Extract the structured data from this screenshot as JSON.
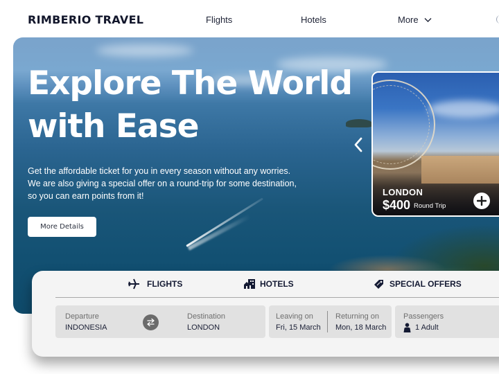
{
  "header": {
    "logo": "RIMBERIO TRAVEL",
    "nav": [
      {
        "label": "Flights"
      },
      {
        "label": "Hotels"
      },
      {
        "label": "More",
        "icon": "chevron-down-icon"
      }
    ]
  },
  "hero": {
    "title_line1": "Explore The World",
    "title_line2": "with Ease",
    "description_line1": "Get the affordable ticket for you in every season without any worries.",
    "description_line2": "We are also giving a special offer on a round-trip for some destination,",
    "description_line3": "so you can earn points from it!",
    "cta_label": "More Details",
    "prev_icon": "chevron-left-icon"
  },
  "destination_card": {
    "city": "LONDON",
    "price": "$400",
    "trip_type": "Round Trip",
    "action_icon": "plus-circle-icon"
  },
  "search": {
    "tabs": [
      {
        "label": "FLIGHTS",
        "icon": "airplane-icon"
      },
      {
        "label": "HOTELS",
        "icon": "hotel-building-icon"
      },
      {
        "label": "SPECIAL OFFERS",
        "icon": "tag-icon"
      }
    ],
    "departure": {
      "label": "Departure",
      "value": "INDONESIA"
    },
    "destination": {
      "label": "Destination",
      "value": "LONDON"
    },
    "swap_icon": "swap-arrows-icon",
    "leaving": {
      "label": "Leaving on",
      "value": "Fri, 15 March"
    },
    "returning": {
      "label": "Returning on",
      "value": "Mon, 18 March"
    },
    "passengers": {
      "label": "Passengers",
      "value": "1 Adult",
      "icon": "person-icon"
    }
  },
  "colors": {
    "text_primary": "#141a33",
    "panel_bg": "#f4f4f4",
    "field_bg": "#e1e1e1",
    "swap_bg": "#6b6b6b"
  }
}
